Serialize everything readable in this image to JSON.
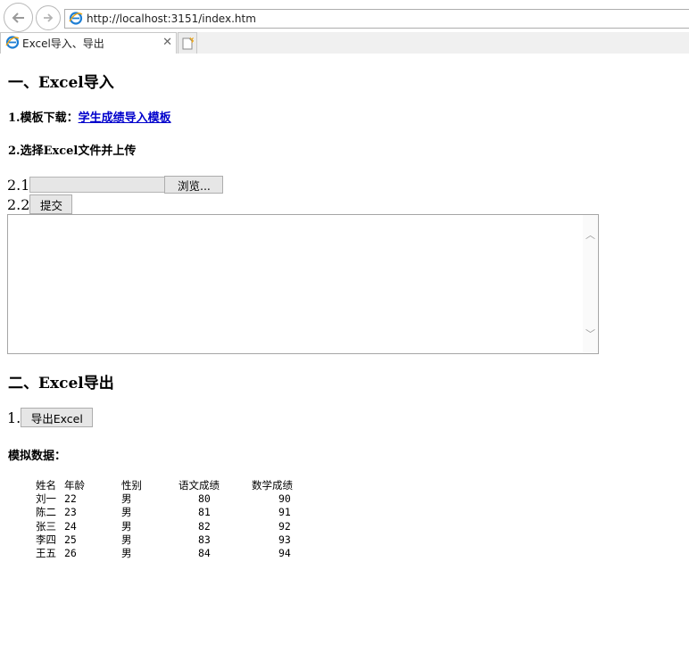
{
  "browser": {
    "url": "http://localhost:3151/index.htm",
    "tab_title": "Excel导入、导出",
    "tab_close": "✕"
  },
  "import": {
    "heading": "一、Excel导入",
    "step1_label": "1.模板下载：",
    "template_link": "学生成绩导入模板",
    "step2_label": "2.选择Excel文件并上传",
    "row1_prefix": "2.1",
    "browse_label": "浏览...",
    "row2_prefix": "2.2",
    "submit_label": "提交",
    "result_text": ""
  },
  "export": {
    "heading": "二、Excel导出",
    "row_prefix": "1.",
    "export_label": "导出Excel",
    "mock_label": "模拟数据："
  },
  "table": {
    "headers": [
      "姓名",
      "年龄",
      "性别",
      "语文成绩",
      "数学成绩"
    ],
    "rows": [
      [
        "刘一",
        "22",
        "男",
        "80",
        "90"
      ],
      [
        "陈二",
        "23",
        "男",
        "81",
        "91"
      ],
      [
        "张三",
        "24",
        "男",
        "82",
        "92"
      ],
      [
        "李四",
        "25",
        "男",
        "83",
        "93"
      ],
      [
        "王五",
        "26",
        "男",
        "84",
        "94"
      ]
    ]
  }
}
